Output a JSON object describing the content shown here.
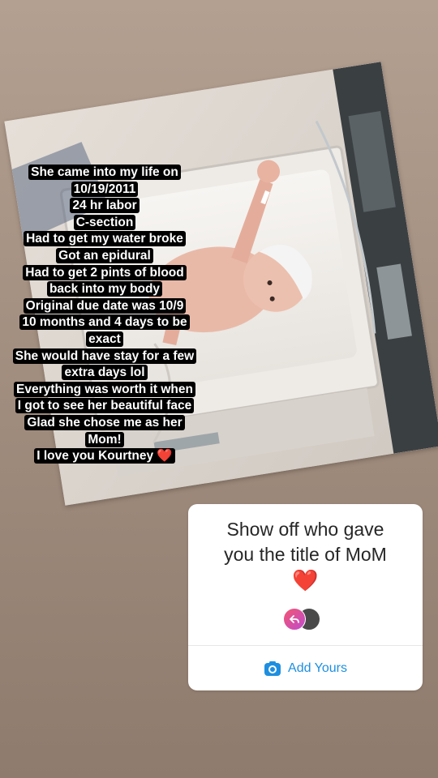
{
  "story": {
    "caption_lines": [
      "She came into my life on",
      "10/19/2011",
      "24 hr labor",
      "C-section",
      "Had to get my water broke",
      "Got an epidural",
      "Had to get 2 pints of blood",
      "back into my body",
      "Original due date was 10/9",
      "10 months and 4 days to be",
      "exact",
      "She would have stay for a few",
      "extra days lol",
      "Everything was worth it when",
      "I got to see her beautiful face",
      "Glad she chose me as her",
      "Mom!",
      "I love you Kourtney"
    ],
    "caption_heart": "❤️",
    "photo_icon": "newborn-photo"
  },
  "sticker": {
    "prompt_line1": "Show off who gave",
    "prompt_line2": "you the title of MoM",
    "heart": "❤️",
    "add_yours_label": "Add Yours",
    "icon": "camera-icon",
    "accent_color": "#1e8fe0"
  }
}
